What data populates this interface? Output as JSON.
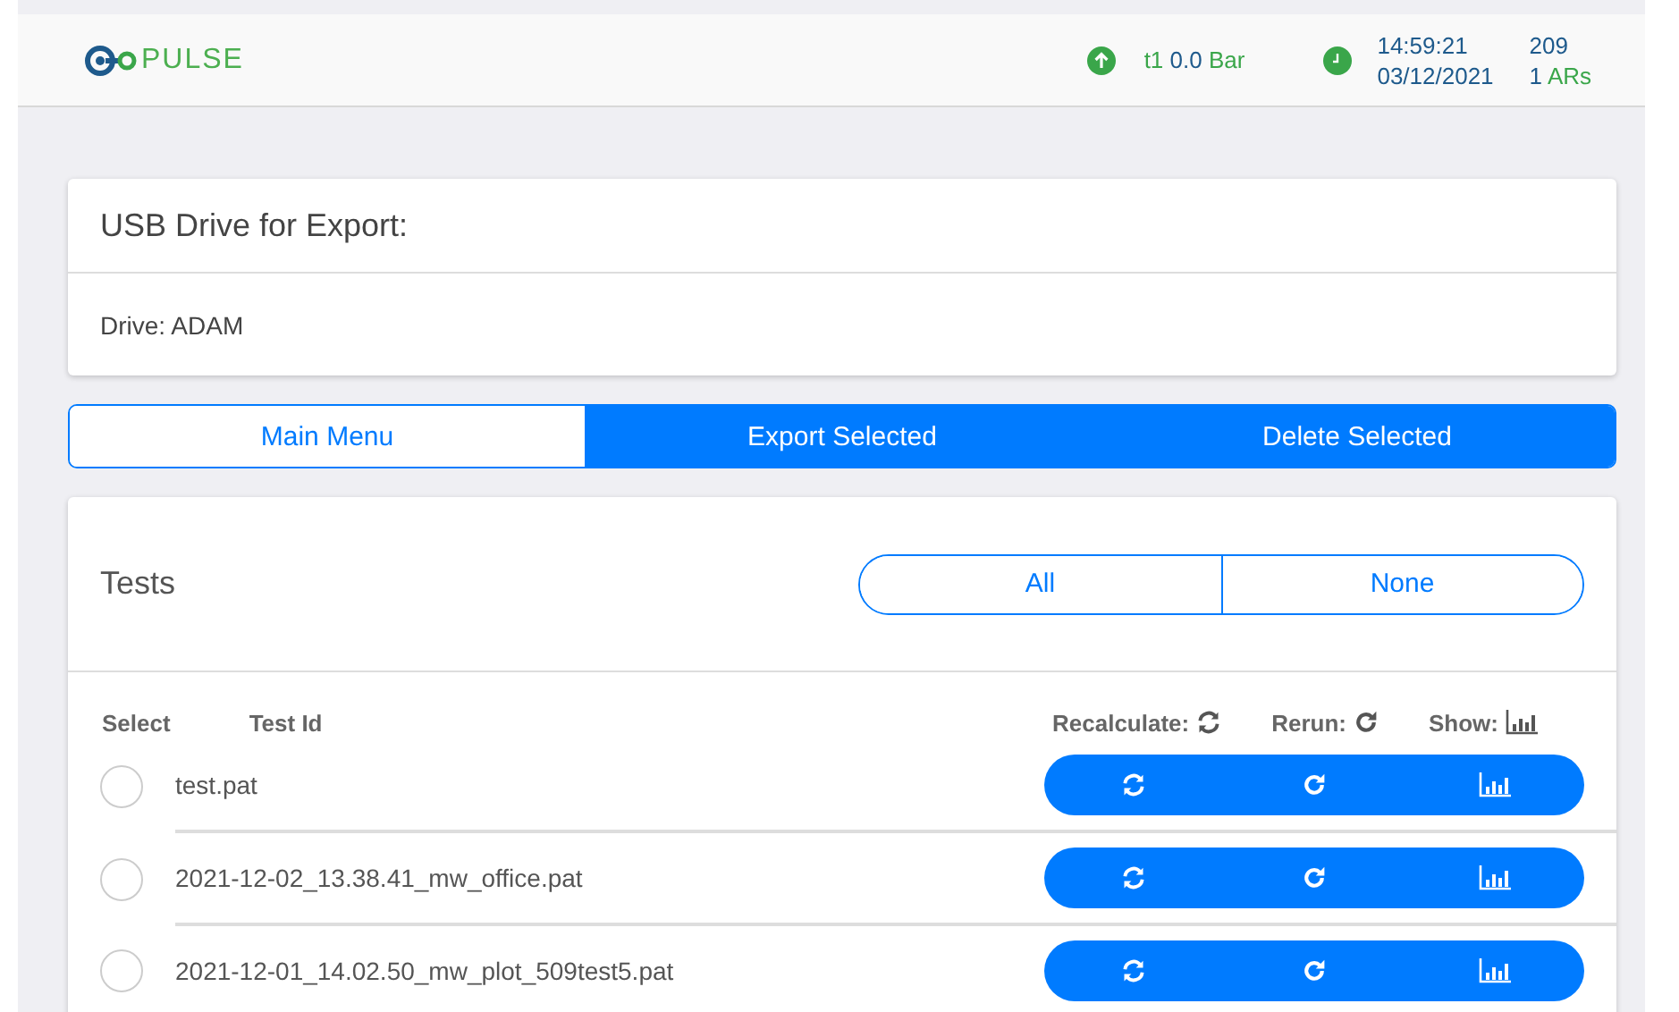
{
  "header": {
    "logo": "PULSE",
    "sensor": {
      "name": "t1",
      "value": "0.0",
      "unit": "Bar"
    },
    "time": "14:59:21",
    "date": "03/12/2021",
    "count": "209",
    "ar_count": "1",
    "ar_label": "ARs"
  },
  "usb_card": {
    "title": "USB Drive for Export:",
    "drive": "Drive: ADAM"
  },
  "actions": [
    {
      "label": "Main Menu",
      "kind": "outline"
    },
    {
      "label": "Export Selected",
      "kind": "filled"
    },
    {
      "label": "Delete Selected",
      "kind": "filled"
    }
  ],
  "tests": {
    "title": "Tests",
    "filters": [
      "All",
      "None"
    ],
    "columns": {
      "select": "Select",
      "test_id": "Test Id",
      "recalculate": "Recalculate:",
      "rerun": "Rerun:",
      "show": "Show:"
    },
    "rows": [
      {
        "id": "test.pat",
        "selected": false
      },
      {
        "id": "2021-12-02_13.38.41_mw_office.pat",
        "selected": false
      },
      {
        "id": "2021-12-01_14.02.50_mw_plot_509test5.pat",
        "selected": false
      }
    ]
  }
}
